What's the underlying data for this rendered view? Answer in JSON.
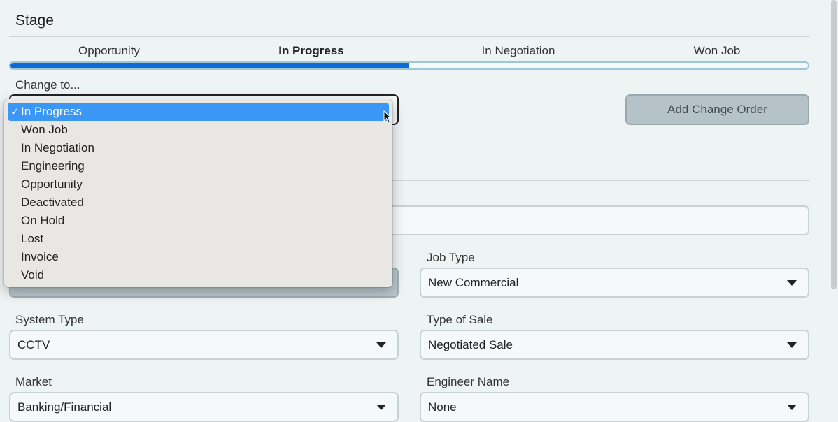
{
  "section": {
    "title": "Stage"
  },
  "stages": [
    "Opportunity",
    "In Progress",
    "In Negotiation",
    "Won Job"
  ],
  "active_stage": "In Progress",
  "progress_fraction": 0.5,
  "change_to": {
    "label": "Change to...",
    "options": [
      "In Progress",
      "Won Job",
      "In Negotiation",
      "Engineering",
      "Opportunity",
      "Deactivated",
      "On Hold",
      "Lost",
      "Invoice",
      "Void"
    ],
    "selected": "In Progress"
  },
  "add_change_order": {
    "label": "Add Change Order"
  },
  "fields": {
    "job_type": {
      "label": "Job Type",
      "value": "New Commercial"
    },
    "system_type": {
      "label": "System Type",
      "value": "CCTV"
    },
    "type_of_sale": {
      "label": "Type of Sale",
      "value": "Negotiated Sale"
    },
    "market": {
      "label": "Market",
      "value": "Banking/Financial"
    },
    "engineer_name": {
      "label": "Engineer Name",
      "value": "None"
    }
  },
  "colors": {
    "accent": "#0d6bd6",
    "selection": "#3b97f6",
    "button_bg": "#b5c3c8"
  },
  "icons": {
    "check": "checkmark-icon",
    "caret": "caret-down-icon",
    "cursor": "mouse-pointer-icon"
  }
}
